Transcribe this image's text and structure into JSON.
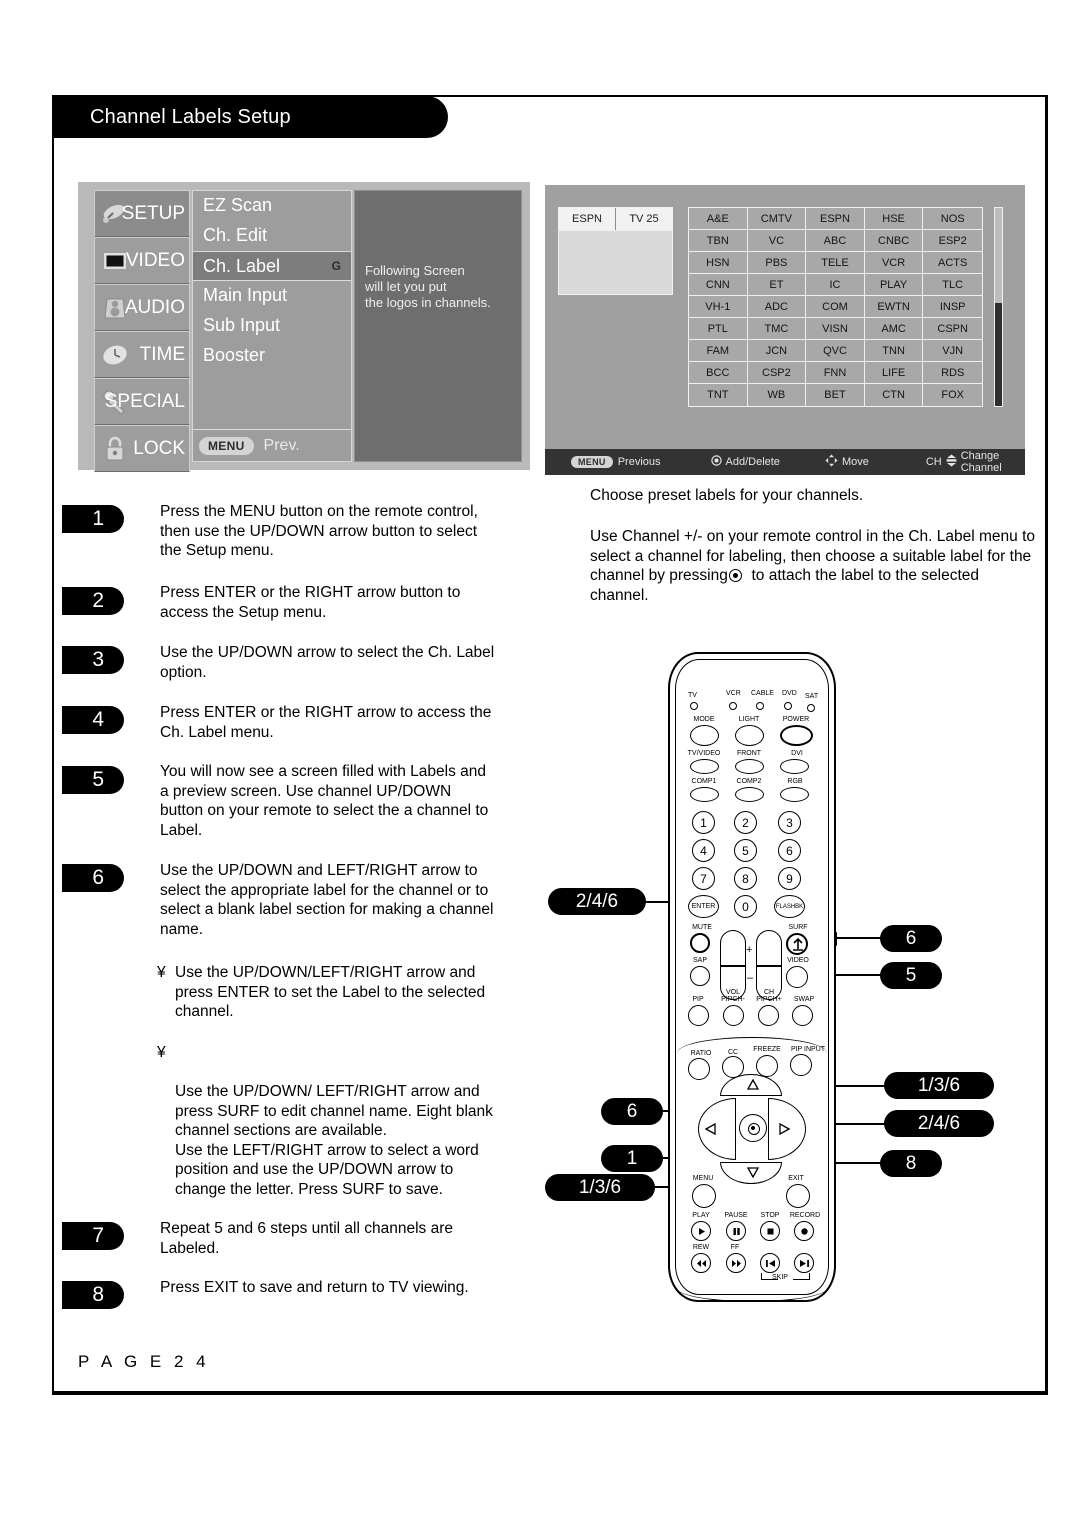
{
  "page": {
    "title": "Channel Labels Setup",
    "page_label": "P A G E   2 4"
  },
  "osd_setup_menu": {
    "categories": [
      {
        "name": "SETUP",
        "icon": "satellite-dish-icon",
        "selected": true
      },
      {
        "name": "VIDEO",
        "icon": "tv-screen-icon",
        "selected": false
      },
      {
        "name": "AUDIO",
        "icon": "speaker-icon",
        "selected": false
      },
      {
        "name": "TIME",
        "icon": "clock-icon",
        "selected": false
      },
      {
        "name": "SPECIAL",
        "icon": "wrench-icon",
        "selected": false
      },
      {
        "name": "LOCK",
        "icon": "padlock-icon",
        "selected": false
      }
    ],
    "items": [
      {
        "label": "EZ Scan",
        "badge": "",
        "highlighted": false
      },
      {
        "label": "Ch. Edit",
        "badge": "",
        "highlighted": false
      },
      {
        "label": "Ch. Label",
        "badge": "G",
        "highlighted": true
      },
      {
        "label": "Main Input",
        "badge": "",
        "highlighted": false
      },
      {
        "label": "Sub Input",
        "badge": "",
        "highlighted": false
      },
      {
        "label": "Booster",
        "badge": "",
        "highlighted": false
      }
    ],
    "footer": {
      "key": "MENU",
      "action": "Prev."
    },
    "help_lines": [
      "Following Screen",
      "will let you put",
      "the logos in channels."
    ]
  },
  "osd_label_screen": {
    "preview": {
      "channel_label": "ESPN",
      "channel_number": "TV 25"
    },
    "label_grid": [
      [
        "A&E",
        "CMTV",
        "ESPN",
        "HSE",
        "NOS"
      ],
      [
        "TBN",
        "VC",
        "ABC",
        "CNBC",
        "ESP2"
      ],
      [
        "HSN",
        "PBS",
        "TELE",
        "VCR",
        "ACTS"
      ],
      [
        "CNN",
        "ET",
        "IC",
        "PLAY",
        "TLC"
      ],
      [
        "VH-1",
        "ADC",
        "COM",
        "EWTN",
        "INSP"
      ],
      [
        "PTL",
        "TMC",
        "VISN",
        "AMC",
        "CSPN"
      ],
      [
        "FAM",
        "JCN",
        "QVC",
        "TNN",
        "VJN"
      ],
      [
        "BCC",
        "CSP2",
        "FNN",
        "LIFE",
        "RDS"
      ],
      [
        "TNT",
        "WB",
        "BET",
        "CTN",
        "FOX"
      ]
    ],
    "bottom_bar": [
      {
        "key": "MENU",
        "label": "Previous",
        "icon": "menu-pill-icon"
      },
      {
        "key": "",
        "label": "Add/Delete",
        "icon": "enter-dot-icon"
      },
      {
        "key": "",
        "label": "Move",
        "icon": "four-arrows-icon"
      },
      {
        "key": "CH",
        "label": "Change Channel",
        "icon": "ch-updown-icon"
      }
    ]
  },
  "steps": [
    {
      "num": "1",
      "text": "Press the MENU button on the remote control, then use the UP/DOWN arrow button to select the Setup menu."
    },
    {
      "num": "2",
      "text": "Press ENTER or the RIGHT arrow button to access the Setup menu."
    },
    {
      "num": "3",
      "text": "Use the UP/DOWN arrow to select the Ch. Label option."
    },
    {
      "num": "4",
      "text": "Press ENTER or the RIGHT arrow to access the Ch. Label menu."
    },
    {
      "num": "5",
      "text": "You will now see a screen filled with Labels and a preview screen. Use channel UP/DOWN button on your remote to select the a channel to Label."
    },
    {
      "num": "6",
      "text": "Use the UP/DOWN and LEFT/RIGHT arrow to select the appropriate label for the channel or to select  a blank label section for making a channel name."
    },
    {
      "num": "7",
      "text": "Repeat 5 and 6 steps until all channels are Labeled."
    },
    {
      "num": "8",
      "text": "Press EXIT to save and return to TV viewing."
    }
  ],
  "bullets": [
    {
      "marker": "¥",
      "text": "Use the UP/DOWN/LEFT/RIGHT arrow and press ENTER to set the Label to the selected channel."
    },
    {
      "marker": "¥",
      "text": "Use the UP/DOWN/ LEFT/RIGHT arrow and press SURF to edit channel name. Eight blank channel sections are available.\nUse the LEFT/RIGHT arrow to select a word position and use the UP/DOWN arrow to change the letter. Press SURF to save."
    }
  ],
  "right_column": {
    "intro": "Choose preset labels for your channels.",
    "body_part1": "Use Channel +/- on your remote control in the Ch. Label menu to select a channel for labeling, then choose a suitable label for the channel by pressing",
    "body_part2": "to attach the label to the selected channel."
  },
  "callouts": [
    {
      "id": "enter-callout",
      "text": "2/4/6",
      "target": "ENTER"
    },
    {
      "id": "surf-callout",
      "text": "6",
      "target": "SURF"
    },
    {
      "id": "ch-callout",
      "text": "5",
      "target": "CH"
    },
    {
      "id": "up-arrow-callout",
      "text": "1/3/6",
      "target": "UP"
    },
    {
      "id": "right-arrow-callout",
      "text": "2/4/6",
      "target": "RIGHT"
    },
    {
      "id": "exit-callout",
      "text": "8",
      "target": "EXIT"
    },
    {
      "id": "left-arrow-callout",
      "text": "6",
      "target": "LEFT"
    },
    {
      "id": "menu-callout",
      "text": "1",
      "target": "MENU"
    },
    {
      "id": "down-arrow-callout",
      "text": "1/3/6",
      "target": "DOWN"
    }
  ],
  "remote": {
    "mode_indicators": [
      "TV",
      "VCR",
      "CABLE",
      "DVD",
      "SAT"
    ],
    "row_mode": [
      "MODE",
      "LIGHT",
      "POWER"
    ],
    "row_input1": [
      "TV/VIDEO",
      "FRONT",
      "DVI"
    ],
    "row_input2": [
      "COMP1",
      "COMP2",
      "RGB"
    ],
    "keypad": [
      "1",
      "2",
      "3",
      "4",
      "5",
      "6",
      "7",
      "8",
      "9"
    ],
    "keypad_bottom": [
      "ENTER",
      "0",
      "FLASHBK"
    ],
    "row_mute": [
      "MUTE",
      "SURF"
    ],
    "row_sap": [
      "SAP",
      "VIDEO"
    ],
    "rockers": [
      "VOL",
      "CH"
    ],
    "rocker_signs": [
      "+",
      "–"
    ],
    "row_pip": [
      "PIP",
      "PIPCH-",
      "PIPCH+",
      "SWAP"
    ],
    "row_ratio": [
      "RATIO",
      "CC",
      "FREEZE",
      "PIP INPUT"
    ],
    "row_menu_exit": [
      "MENU",
      "EXIT"
    ],
    "transport_top": [
      "PLAY",
      "PAUSE",
      "STOP",
      "RECORD"
    ],
    "transport_bottom": [
      "REW",
      "FF"
    ],
    "skip_label": "SKIP"
  }
}
